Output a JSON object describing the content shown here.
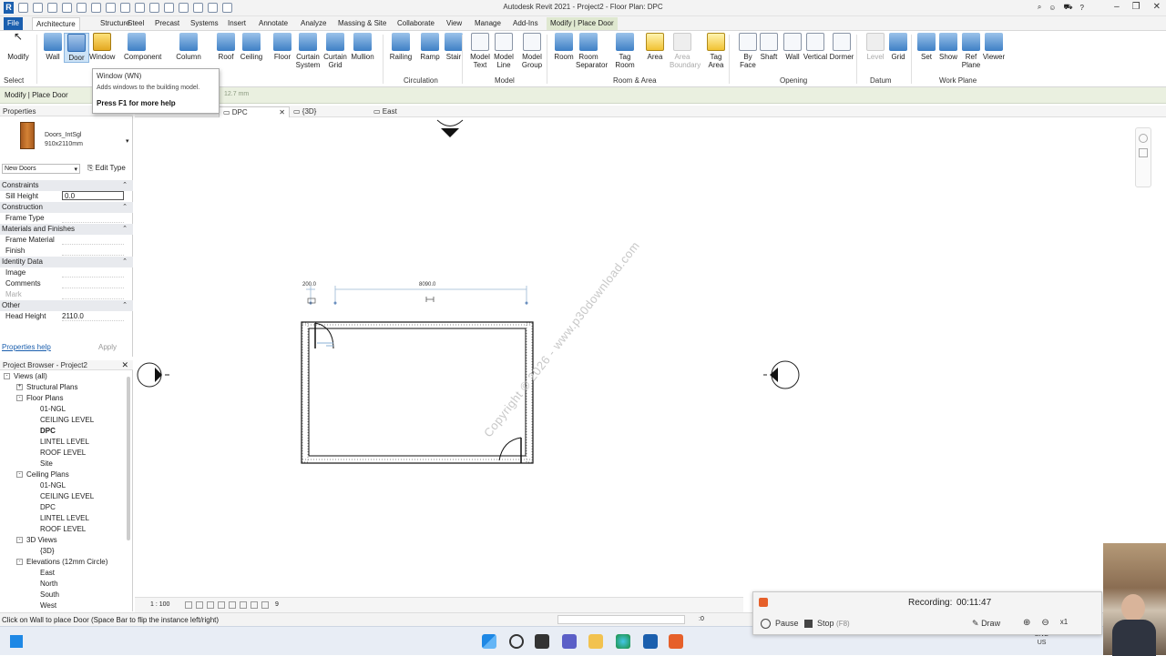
{
  "window": {
    "title": "Autodesk Revit 2021 - Project2 - Floor Plan: DPC"
  },
  "ribbon_tabs": [
    {
      "label": "File",
      "state": "file"
    },
    {
      "label": "Architecture",
      "state": "active"
    },
    {
      "label": "Structure"
    },
    {
      "label": "Steel"
    },
    {
      "label": "Precast"
    },
    {
      "label": "Systems"
    },
    {
      "label": "Insert"
    },
    {
      "label": "Annotate"
    },
    {
      "label": "Analyze"
    },
    {
      "label": "Massing & Site"
    },
    {
      "label": "Collaborate"
    },
    {
      "label": "View"
    },
    {
      "label": "Manage"
    },
    {
      "label": "Add-Ins"
    },
    {
      "label": "Modify | Place Door",
      "state": "context"
    }
  ],
  "ribbon_buttons": [
    {
      "label": "Modify",
      "icon": "cursor-icon"
    },
    {
      "label": "Wall",
      "icon": "wall-icon"
    },
    {
      "label": "Door",
      "icon": "door-icon",
      "selected": true
    },
    {
      "label": "Window",
      "icon": "window-icon",
      "hover": true
    },
    {
      "label": "Component",
      "icon": "component-icon"
    },
    {
      "label": "Column",
      "icon": "column-icon"
    },
    {
      "label": "Roof",
      "icon": "roof-icon"
    },
    {
      "label": "Ceiling",
      "icon": "ceiling-icon"
    },
    {
      "label": "Floor",
      "icon": "floor-icon"
    },
    {
      "label": "Curtain System",
      "icon": "curtain-system-icon"
    },
    {
      "label": "Curtain Grid",
      "icon": "curtain-grid-icon"
    },
    {
      "label": "Mullion",
      "icon": "mullion-icon"
    },
    {
      "label": "Railing",
      "icon": "railing-icon"
    },
    {
      "label": "Ramp",
      "icon": "ramp-icon"
    },
    {
      "label": "Stair",
      "icon": "stair-icon"
    },
    {
      "label": "Model Text",
      "icon": "model-text-icon"
    },
    {
      "label": "Model Line",
      "icon": "model-line-icon"
    },
    {
      "label": "Model Group",
      "icon": "model-group-icon"
    },
    {
      "label": "Room",
      "icon": "room-icon"
    },
    {
      "label": "Room Separator",
      "icon": "room-separator-icon"
    },
    {
      "label": "Tag Room",
      "icon": "tag-room-icon"
    },
    {
      "label": "Area",
      "icon": "area-icon"
    },
    {
      "label": "Area Boundary",
      "icon": "area-boundary-icon",
      "disabled": true
    },
    {
      "label": "Tag Area",
      "icon": "tag-area-icon"
    },
    {
      "label": "By Face",
      "icon": "by-face-icon"
    },
    {
      "label": "Shaft",
      "icon": "shaft-icon"
    },
    {
      "label": "Wall",
      "icon": "wall-opening-icon"
    },
    {
      "label": "Vertical",
      "icon": "vertical-opening-icon"
    },
    {
      "label": "Dormer",
      "icon": "dormer-icon"
    },
    {
      "label": "Level",
      "icon": "level-icon",
      "disabled": true
    },
    {
      "label": "Grid",
      "icon": "grid-icon"
    },
    {
      "label": "Set",
      "icon": "set-icon"
    },
    {
      "label": "Show",
      "icon": "show-icon"
    },
    {
      "label": "Ref Plane",
      "icon": "ref-plane-icon"
    },
    {
      "label": "Viewer",
      "icon": "viewer-icon"
    }
  ],
  "ribbon_groups": [
    "Select",
    "Circulation",
    "Model",
    "Room & Area",
    "Opening",
    "Datum",
    "Work Plane"
  ],
  "options_bar": {
    "context_label": "Modify | Place Door",
    "dim_hint": "12.7 mm"
  },
  "tooltip": {
    "title": "Window (WN)",
    "description": "Adds windows to the building model.",
    "help": "Press F1 for more help"
  },
  "properties": {
    "header": "Properties",
    "type_family": "Doors_IntSgl",
    "type_size": "910x2110mm",
    "selector": "New Doors",
    "edit_type": "Edit Type",
    "rows": [
      {
        "kind": "cat",
        "label": "Constraints"
      },
      {
        "kind": "item",
        "label": "Sill Height",
        "value": "0.0",
        "box": true
      },
      {
        "kind": "cat",
        "label": "Construction"
      },
      {
        "kind": "item",
        "label": "Frame Type",
        "value": ""
      },
      {
        "kind": "cat",
        "label": "Materials and Finishes"
      },
      {
        "kind": "item",
        "label": "Frame Material",
        "value": ""
      },
      {
        "kind": "item",
        "label": "Finish",
        "value": ""
      },
      {
        "kind": "cat",
        "label": "Identity Data"
      },
      {
        "kind": "item",
        "label": "Image",
        "value": ""
      },
      {
        "kind": "item",
        "label": "Comments",
        "value": ""
      },
      {
        "kind": "item",
        "label": "Mark",
        "value": "",
        "dim": true
      },
      {
        "kind": "cat",
        "label": "Other"
      },
      {
        "kind": "item",
        "label": "Head Height",
        "value": "2110.0"
      }
    ],
    "help_link": "Properties help",
    "apply": "Apply"
  },
  "browser": {
    "header": "Project Browser - Project2",
    "nodes": [
      {
        "label": "Views (all)",
        "level": 0,
        "expander": "-"
      },
      {
        "label": "Structural Plans",
        "level": 1,
        "expander": "+"
      },
      {
        "label": "Floor Plans",
        "level": 1,
        "expander": "-"
      },
      {
        "label": "01-NGL",
        "level": 2
      },
      {
        "label": "CEILING LEVEL",
        "level": 2
      },
      {
        "label": "DPC",
        "level": 2,
        "bold": true
      },
      {
        "label": "LINTEL LEVEL",
        "level": 2
      },
      {
        "label": "ROOF LEVEL",
        "level": 2
      },
      {
        "label": "Site",
        "level": 2
      },
      {
        "label": "Ceiling Plans",
        "level": 1,
        "expander": "-"
      },
      {
        "label": "01-NGL",
        "level": 2
      },
      {
        "label": "CEILING LEVEL",
        "level": 2
      },
      {
        "label": "DPC",
        "level": 2
      },
      {
        "label": "LINTEL LEVEL",
        "level": 2
      },
      {
        "label": "ROOF LEVEL",
        "level": 2
      },
      {
        "label": "3D Views",
        "level": 1,
        "expander": "-"
      },
      {
        "label": "{3D}",
        "level": 2
      },
      {
        "label": "Elevations (12mm Circle)",
        "level": 1,
        "expander": "-"
      },
      {
        "label": "East",
        "level": 2
      },
      {
        "label": "North",
        "level": 2
      },
      {
        "label": "South",
        "level": 2
      },
      {
        "label": "West",
        "level": 2
      }
    ]
  },
  "view_tabs": [
    {
      "label": "DPC",
      "active": true
    },
    {
      "label": "{3D}"
    },
    {
      "label": "East"
    }
  ],
  "canvas": {
    "dim_left": "200.0",
    "dim_top": "8090.0",
    "watermark": "Copyright © 2026 - www.p30download.com"
  },
  "view_control": {
    "scale": "1 : 100",
    "hidden_count": "9"
  },
  "status": {
    "message": "Click on Wall to place Door (Space Bar to flip the instance left/right)",
    "filter": ":0"
  },
  "recording": {
    "label": "Recording:",
    "time": "00:11:47",
    "pause": "Pause",
    "stop": "Stop",
    "stop_key": "(F8)",
    "draw": "Draw",
    "zoom": "x1"
  },
  "taskbar": {
    "lang": "ENG",
    "region": "US"
  }
}
